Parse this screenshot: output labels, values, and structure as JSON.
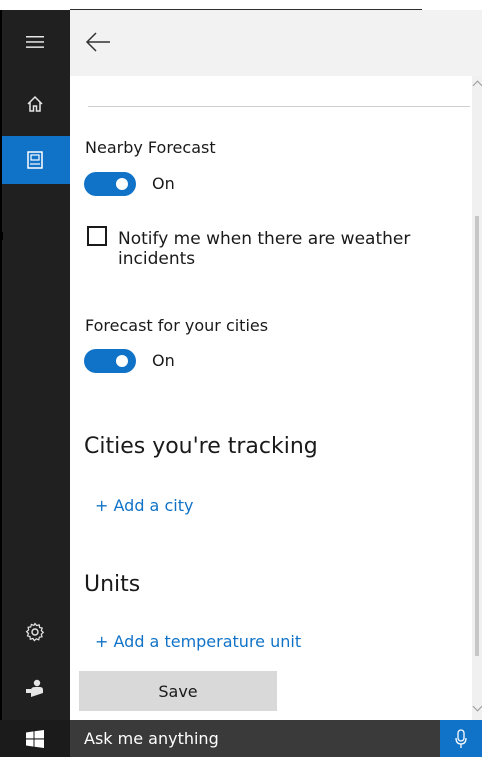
{
  "colors": {
    "accent": "#1173c8",
    "sidebar": "#202020",
    "taskbar": "#2b2b2b",
    "header": "#f2f2f2"
  },
  "sidebar": {
    "items": [
      {
        "icon": "hamburger-menu-icon"
      },
      {
        "icon": "home-icon"
      },
      {
        "icon": "notebook-icon",
        "active": true
      },
      {
        "icon": "gear-icon"
      },
      {
        "icon": "feedback-icon"
      }
    ]
  },
  "header": {
    "back_icon": "back-arrow-icon"
  },
  "nearby_forecast": {
    "label": "Nearby Forecast",
    "toggle_state": "On"
  },
  "notify": {
    "label": "Notify me when there are weather incidents",
    "checked": false
  },
  "forecast_cities": {
    "label": "Forecast for your cities",
    "toggle_state": "On"
  },
  "cities_tracking": {
    "heading": "Cities you're tracking",
    "add_link": "+ Add a city"
  },
  "units": {
    "heading": "Units",
    "add_link": "+ Add a temperature unit"
  },
  "save_label": "Save",
  "taskbar": {
    "search_text": "Ask me anything",
    "start_icon": "windows-logo-icon",
    "mic_icon": "microphone-icon"
  }
}
